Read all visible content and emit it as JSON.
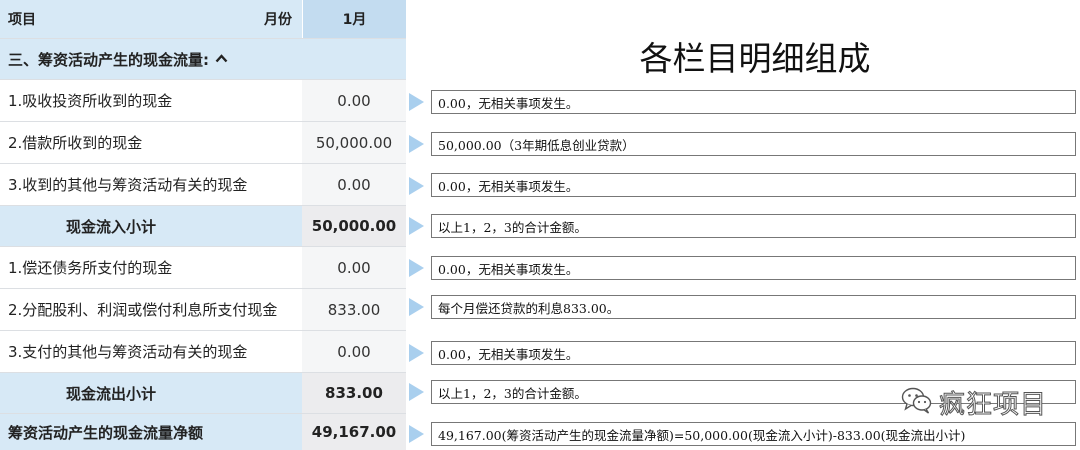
{
  "header": {
    "item_label": "项目",
    "month_label": "月份",
    "month_value": "1月"
  },
  "section": {
    "title": "三、筹资活动产生的现金流量:"
  },
  "rows": [
    {
      "label": "1.吸收投资所收到的现金",
      "value": "0.00"
    },
    {
      "label": "2.借款所收到的现金",
      "value": "50,000.00"
    },
    {
      "label": "3.收到的其他与筹资活动有关的现金",
      "value": "0.00"
    },
    {
      "label": "现金流入小计",
      "value": "50,000.00"
    },
    {
      "label": "1.偿还债务所支付的现金",
      "value": "0.00"
    },
    {
      "label": "2.分配股利、利润或偿付利息所支付现金",
      "value": "833.00"
    },
    {
      "label": "3.支付的其他与筹资活动有关的现金",
      "value": "0.00"
    },
    {
      "label": "现金流出小计",
      "value": "833.00"
    },
    {
      "label": "筹资活动产生的现金流量净额",
      "value": "49,167.00"
    }
  ],
  "details": {
    "title": "各栏目明细组成",
    "items": [
      "0.00，无相关事项发生。",
      "50,000.00（3年期低息创业贷款）",
      "0.00，无相关事项发生。",
      "以上1，2，3的合计金额。",
      "0.00，无相关事项发生。",
      "每个月偿还贷款的利息833.00。",
      "0.00，无相关事项发生。",
      "以上1，2，3的合计金额。",
      "49,167.00(筹资活动产生的现金流量净额)=50,000.00(现金流入小计)-833.00(现金流出小计)"
    ]
  },
  "watermark": {
    "text": "疯狂项目",
    "icon": "wechat-icon"
  },
  "colors": {
    "header_blue": "#d7e9f6",
    "arrow_blue": "#a9cfee",
    "value_gray": "#f5f6f7"
  }
}
